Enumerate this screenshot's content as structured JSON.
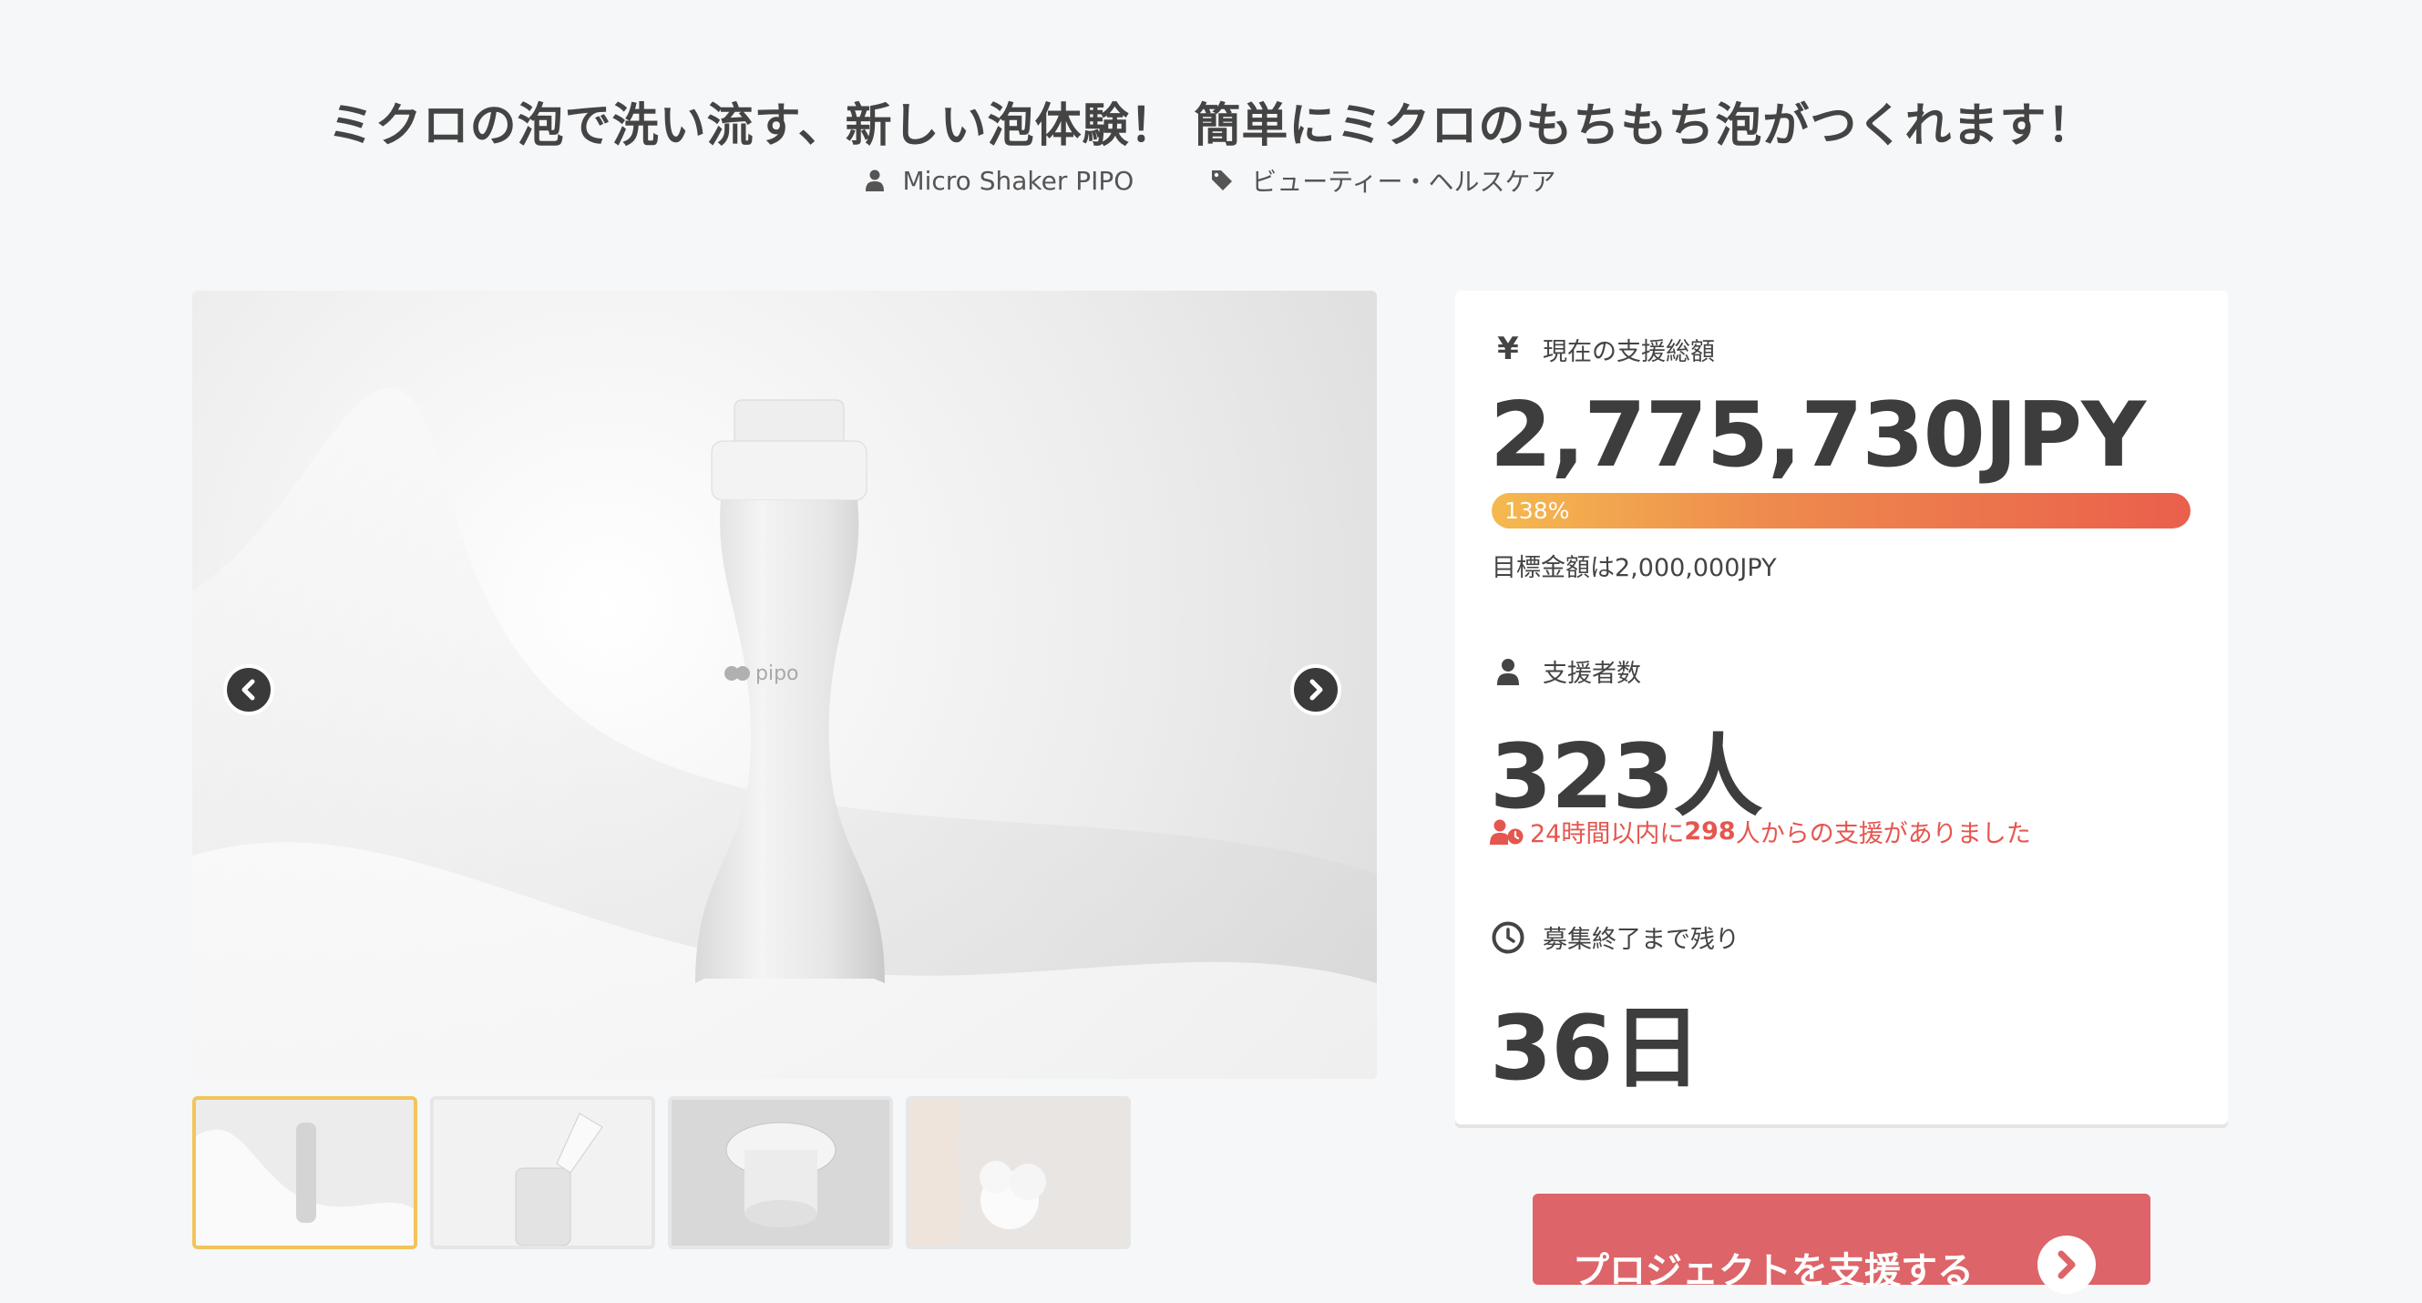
{
  "project": {
    "title": "ミクロの泡で洗い流す、新しい泡体験！ 簡単にミクロのもちもち泡がつくれます！",
    "owner": "Micro Shaker PIPO",
    "category": "ビューティー・ヘルスケア"
  },
  "gallery": {
    "product_logo": "pipo",
    "icons": {
      "prev": "chevron-left-icon",
      "next": "chevron-right-icon"
    },
    "thumbnail_count": 4
  },
  "stats": {
    "total": {
      "label": "現在の支援総額",
      "icon": "yen-icon",
      "value": "2,775,730JPY",
      "progress_text": "138%",
      "progress": 1.38,
      "goal_text": "目標金額は2,000,000JPY"
    },
    "backers": {
      "label": "支援者数",
      "icon": "user-icon",
      "value": "323人",
      "recent_prefix": "24時間以内に",
      "recent_count": "298",
      "recent_suffix": "人からの支援がありました",
      "recent_icon": "user-clock-icon"
    },
    "remaining": {
      "label": "募集終了まで残り",
      "icon": "clock-icon",
      "value": "36日"
    }
  },
  "cta": {
    "label": "プロジェクトを支援する",
    "icon": "arrow-circle-icon"
  },
  "colors": {
    "background": "#f6f7f9",
    "accent_red": "#e5564f",
    "cta": "#dd6468",
    "progress_start": "#f5b94f",
    "progress_end": "#ea5f4c",
    "thumb_active": "#f2c45a"
  }
}
